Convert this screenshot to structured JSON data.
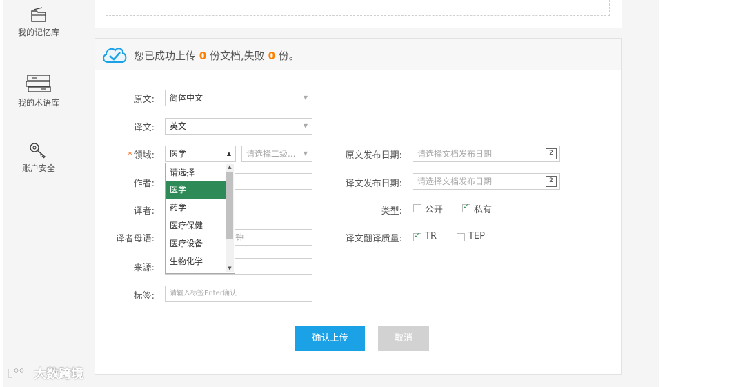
{
  "sidebar": {
    "items": [
      {
        "label": "我的记忆库",
        "icon": "folder-icon"
      },
      {
        "label": "我的术语库",
        "icon": "books-icon"
      },
      {
        "label": "账户安全",
        "icon": "key-icon"
      }
    ]
  },
  "status": {
    "prefix": "您已成功上传",
    "success_count": "0",
    "middle": "份文档,失败",
    "fail_count": "0",
    "suffix": "份。"
  },
  "form": {
    "source_label": "原文:",
    "source_value": "简体中文",
    "target_label": "译文:",
    "target_value": "英文",
    "domain_label": "领域:",
    "domain_value": "医学",
    "subdomain_placeholder": "请选择二级...",
    "author_label": "作者:",
    "translator_label": "译者:",
    "translator_native_label": "译者母语:",
    "translator_native_fragment": "钟",
    "source_origin_label": "来源:",
    "tags_label": "标签:",
    "tags_placeholder": "请输入标签Enter确认",
    "source_date_label": "原文发布日期:",
    "source_date_placeholder": "请选择文档发布日期",
    "target_date_label": "译文发布日期:",
    "target_date_placeholder": "请选择文档发布日期",
    "type_label": "类型:",
    "type_public": "公开",
    "type_private": "私有",
    "quality_label": "译文翻译质量:",
    "quality_tr": "TR",
    "quality_tep": "TEP"
  },
  "checkboxes": {
    "public_checked": false,
    "private_checked": true,
    "tr_checked": true,
    "tep_checked": false
  },
  "domain_options": [
    "请选择",
    "医学",
    "药学",
    "医疗保健",
    "医疗设备",
    "生物化学"
  ],
  "domain_selected": "医学",
  "buttons": {
    "confirm": "确认上传",
    "cancel": "取消"
  },
  "watermark": "大数跨境",
  "colors": {
    "accent": "#1aa1e6",
    "highlight": "#ff7f00",
    "selected_option": "#2e8b57",
    "cancel_bg": "#d2d2d2"
  }
}
